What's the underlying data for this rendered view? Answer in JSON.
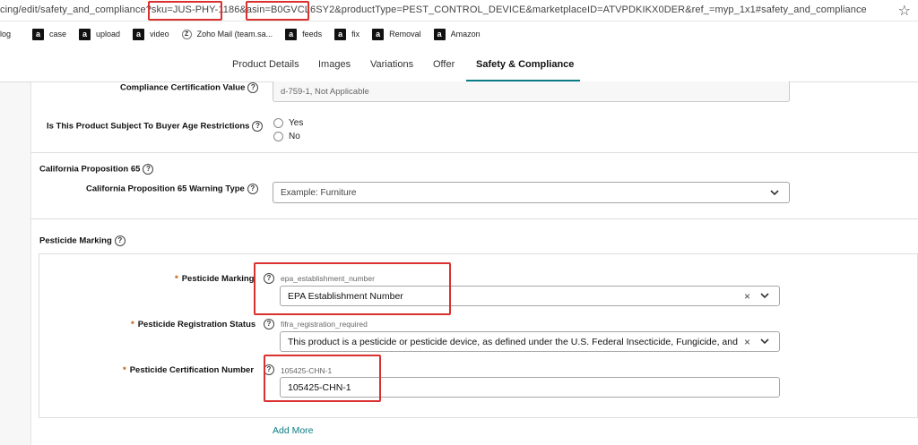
{
  "url": {
    "text": "cing/edit/safety_and_compliance?sku=JUS-PHY-1186&asin=B0GVCL6SY2&productType=PEST_CONTROL_DEVICE&marketplaceID=ATVPDKIKX0DER&ref_=myp_1x1#safety_and_compliance",
    "star": "☆"
  },
  "bookmarks": [
    {
      "icon": "",
      "label": "log"
    },
    {
      "icon": "a",
      "label": "case"
    },
    {
      "icon": "a",
      "label": "upload"
    },
    {
      "icon": "a",
      "label": "video"
    },
    {
      "icon": "Z",
      "label": "Zoho Mail (team.sa..."
    },
    {
      "icon": "a",
      "label": "feeds"
    },
    {
      "icon": "a",
      "label": "fix"
    },
    {
      "icon": "a",
      "label": "Removal"
    },
    {
      "icon": "a",
      "label": "Amazon"
    }
  ],
  "tabs": {
    "product_details": "Product Details",
    "images": "Images",
    "variations": "Variations",
    "offer": "Offer",
    "safety": "Safety & Compliance"
  },
  "fields": {
    "compliance_cert": {
      "label": "Compliance Certification Value",
      "value": "d-759-1, Not Applicable"
    },
    "age_restrictions": {
      "label": "Is This Product Subject To Buyer Age Restrictions",
      "yes": "Yes",
      "no": "No"
    },
    "ca_prop65_section": "California Proposition 65",
    "ca_prop65_warning": {
      "label": "California Proposition 65 Warning Type",
      "placeholder": "Example: Furniture"
    },
    "pesticide_section": "Pesticide Marking",
    "pesticide_marking": {
      "label": "Pesticide Marking",
      "hint": "epa_establishment_number",
      "value": "EPA Establishment Number"
    },
    "pesticide_registration": {
      "label": "Pesticide Registration Status",
      "hint": "fifra_registration_required",
      "value": "This product is a pesticide or pesticide device, as defined under the U.S. Federal Insecticide, Fungicide, and"
    },
    "pesticide_cert": {
      "label": "Pesticide Certification Number",
      "hint": "105425-CHN-1",
      "value": "105425-CHN-1"
    },
    "required_mark": "*",
    "help_glyph": "?",
    "clear_glyph": "×",
    "add_more": "Add More"
  },
  "colors": {
    "accent": "#0a7c86",
    "highlight": "#d9312f",
    "required": "#c45500"
  }
}
